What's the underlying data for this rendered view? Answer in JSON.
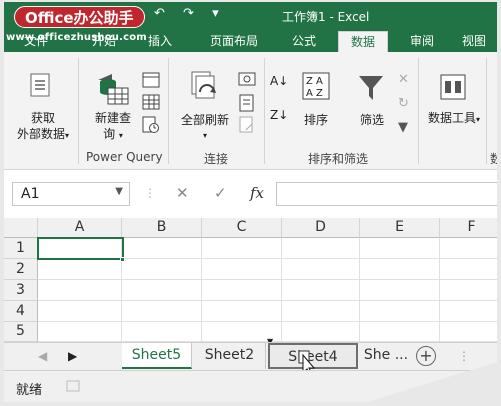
{
  "watermark": {
    "logo": "Office办公助手",
    "url": "www.officezhushou.com"
  },
  "title_bar": {
    "title": "工作簿1 - Excel",
    "undo": "↶",
    "redo": "↷",
    "customize": "▾"
  },
  "ribbon_tabs": [
    {
      "label": "文件"
    },
    {
      "label": "开始"
    },
    {
      "label": "插入"
    },
    {
      "label": "页面布局"
    },
    {
      "label": "公式"
    },
    {
      "label": "数据",
      "active": true
    },
    {
      "label": "审阅"
    },
    {
      "label": "视图"
    }
  ],
  "ribbon": {
    "get_external": {
      "line1": "获取",
      "line2": "外部数据",
      "caret": "▾"
    },
    "new_query": {
      "line1": "新建查",
      "line2": "询",
      "caret": "▾"
    },
    "power_query_label": "Power Query",
    "refresh_all": {
      "label": "全部刷新",
      "caret": "▾"
    },
    "connections_label": "连接",
    "sort": {
      "label": "排序"
    },
    "filter": {
      "label": "筛选"
    },
    "sort_filter_label": "排序和筛选",
    "data_tools": {
      "label": "数据工具",
      "caret": "▾"
    },
    "next_group_label": "数"
  },
  "formula_bar": {
    "name_box": "A1",
    "cancel": "✕",
    "enter": "✓",
    "fx": "fx",
    "formula": ""
  },
  "columns": [
    "A",
    "B",
    "C",
    "D",
    "E",
    "F"
  ],
  "rows": [
    "1",
    "2",
    "3",
    "4",
    "5"
  ],
  "sheet_tabs": [
    {
      "label": "Sheet5"
    },
    {
      "label": "Sheet2"
    },
    {
      "label": "Sheet4"
    },
    {
      "label": "She ..."
    }
  ],
  "status": {
    "text": "就绪"
  },
  "accent_color": "#217346"
}
